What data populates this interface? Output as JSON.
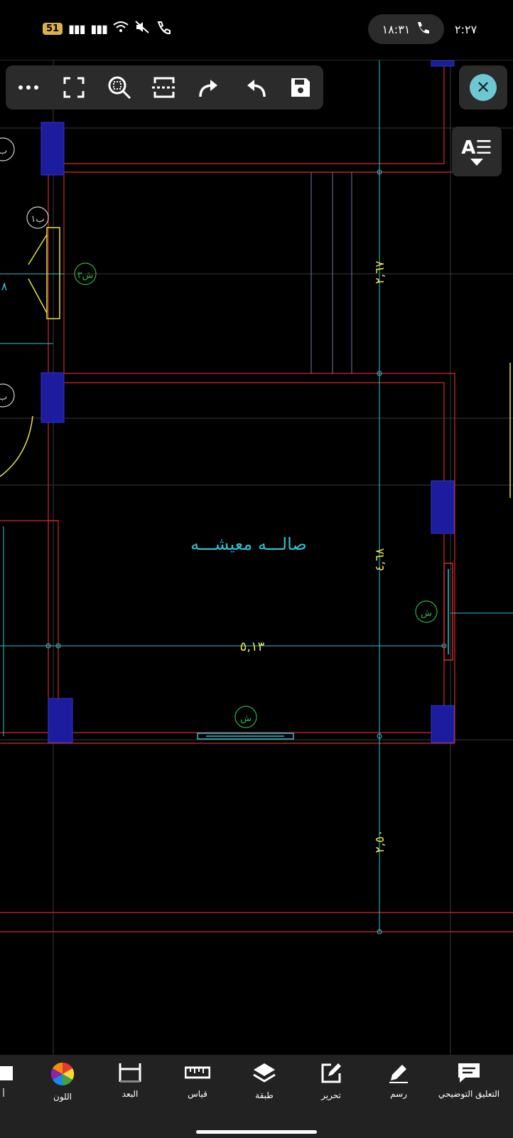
{
  "status": {
    "battery": "51",
    "call_time": "١٨:٣١",
    "clock": "٢:٢٧"
  },
  "toolbar": {
    "icons": [
      "more-icon",
      "fullscreen-icon",
      "zoom-extents-icon",
      "fit-width-icon",
      "redo-icon",
      "undo-icon",
      "save-icon"
    ]
  },
  "drawing": {
    "room_label": "صالـــه معيشـــه",
    "dim_horizontal": "٥,١٣",
    "dim_vertical_1": "٢,٦٧",
    "dim_vertical_2": "٤,٦٨",
    "dim_vertical_3": "٢,٥٠",
    "door_tag_top": "ب١",
    "door_tag_mid": "ب",
    "door_tag_bot": "ب",
    "window_tag_1": "ش",
    "window_tag_2": "ش",
    "window_tag_3": "ش٣",
    "side_num": "٨"
  },
  "bottom_tabs": [
    {
      "id": "annotation",
      "label": "التعليق التوضيحي"
    },
    {
      "id": "draw",
      "label": "رسم"
    },
    {
      "id": "edit",
      "label": "تحرير"
    },
    {
      "id": "layer",
      "label": "طبقة"
    },
    {
      "id": "measure",
      "label": "قياس"
    },
    {
      "id": "dimension",
      "label": "البعد"
    },
    {
      "id": "color",
      "label": "اللون"
    },
    {
      "id": "partial",
      "label": "أ"
    }
  ],
  "colors": {
    "cyan": "#2fc3d3",
    "yellow": "#e6e24a",
    "red": "#d32a2a",
    "green": "#2db34a",
    "blue": "#1c1c9e",
    "grid": "#3a3a3a",
    "accent": "#6ec8d4"
  }
}
